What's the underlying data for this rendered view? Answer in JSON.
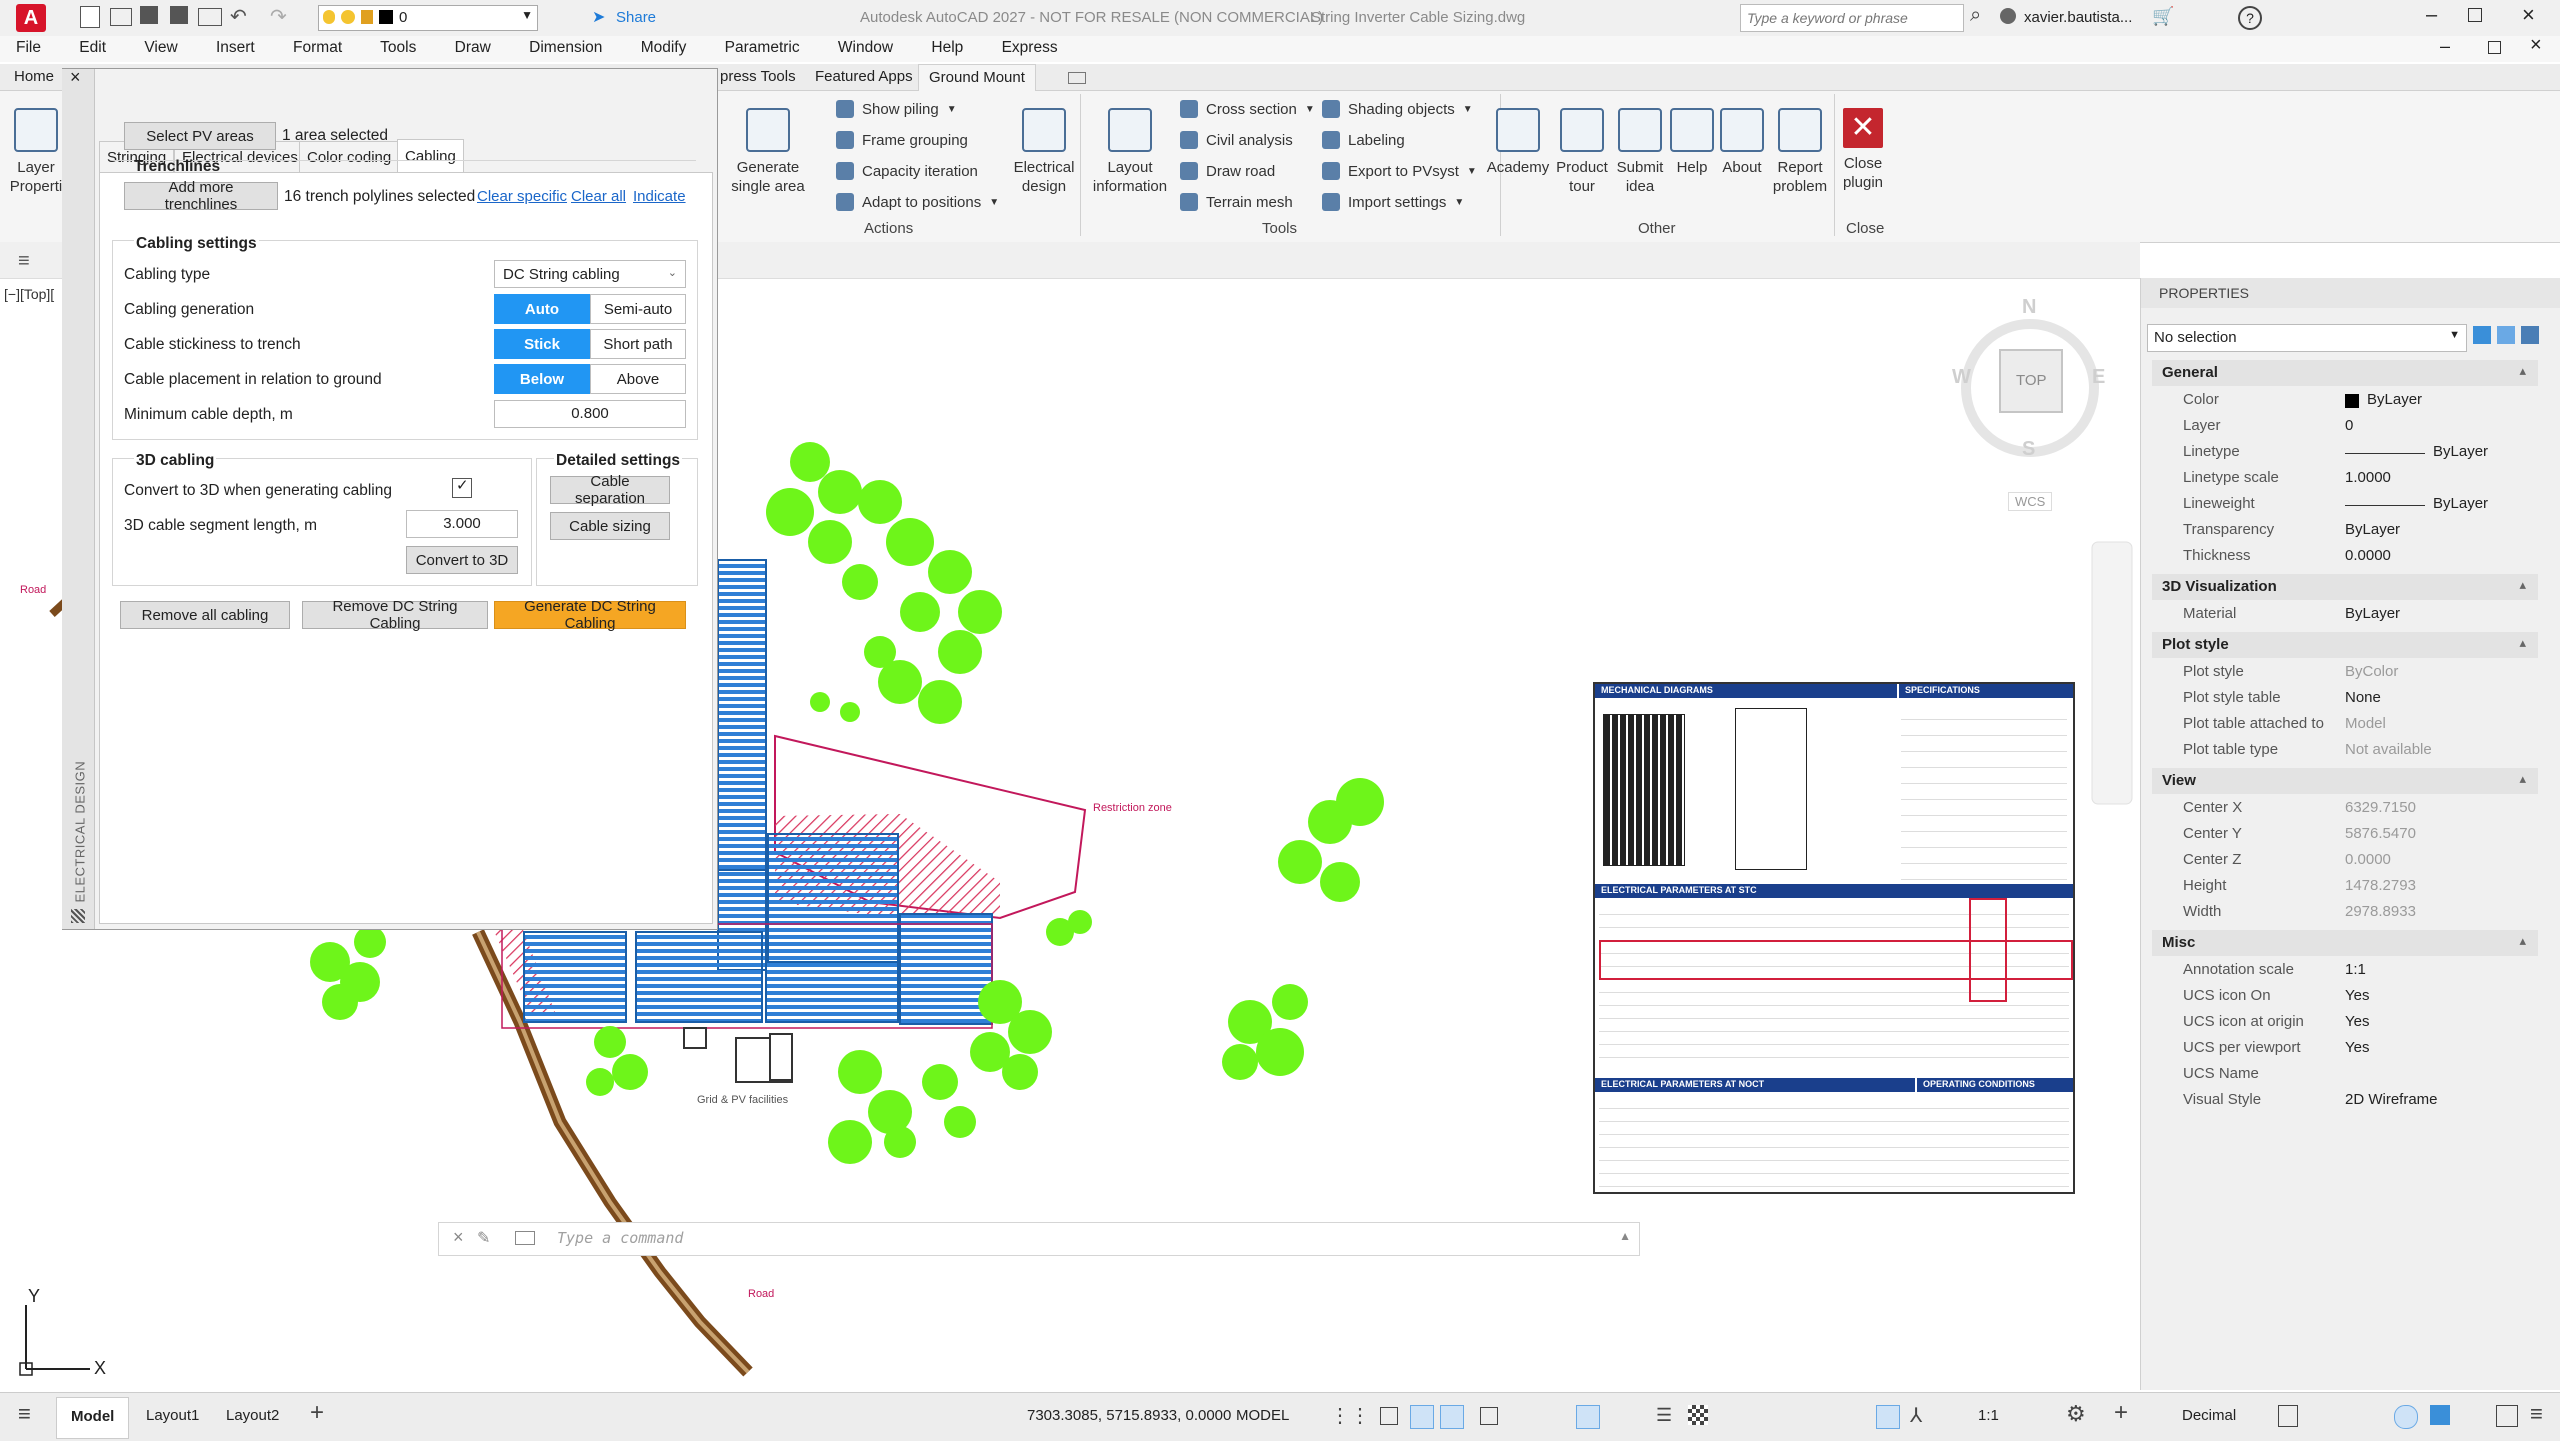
{
  "titlebar": {
    "app_title": "Autodesk AutoCAD 2027 - NOT FOR RESALE (NON COMMERCIAL)",
    "file_name": "String Inverter Cable Sizing.dwg",
    "search_placeholder": "Type a keyword or phrase",
    "user": "xavier.bautista...",
    "layer_value": "0",
    "share_label": "Share",
    "logo_letter": "A"
  },
  "menubar": [
    "File",
    "Edit",
    "View",
    "Insert",
    "Format",
    "Tools",
    "Draw",
    "Dimension",
    "Modify",
    "Parametric",
    "Window",
    "Help",
    "Express"
  ],
  "ribbon_tabs": [
    "Home",
    "press Tools",
    "Featured Apps",
    "Ground Mount"
  ],
  "ribbon_left_label": "Layer Properti",
  "ribbon": {
    "generate_single_area": "Generate single area",
    "show_piling": "Show piling",
    "frame_grouping": "Frame grouping",
    "capacity_iteration": "Capacity iteration",
    "adapt_to_positions": "Adapt to positions",
    "electrical_design": "Electrical design",
    "actions_group": "Actions",
    "layout_information": "Layout information",
    "cross_section": "Cross section",
    "civil_analysis": "Civil analysis",
    "draw_road": "Draw road",
    "terrain_mesh": "Terrain mesh",
    "shading_objects": "Shading objects",
    "labeling": "Labeling",
    "export_to_pvsyst": "Export to PVsyst",
    "import_settings": "Import settings",
    "tools_group": "Tools",
    "academy": "Academy",
    "product_tour": "Product tour",
    "submit_idea": "Submit idea",
    "help": "Help",
    "about": "About",
    "report_problem": "Report problem",
    "other_group": "Other",
    "close_plugin": "Close plugin",
    "close_group": "Close"
  },
  "viewport_label": "[−][Top][",
  "panel": {
    "side_label": "ELECTRICAL DESIGN",
    "tabs": [
      "Stringing",
      "Electrical devices",
      "Color coding",
      "Cabling"
    ],
    "active_tab": "Cabling",
    "select_pv_areas": "Select PV areas",
    "area_selected": "1 area selected",
    "trenchlines_heading": "Trenchlines",
    "add_more_trenchlines": "Add more trenchlines",
    "trench_selected": "16 trench polylines selected",
    "clear_specific": "Clear specific",
    "clear_all": "Clear all",
    "indicate": "Indicate",
    "cabling_settings_heading": "Cabling settings",
    "cabling_type_label": "Cabling type",
    "cabling_type_value": "DC String cabling",
    "cabling_generation_label": "Cabling generation",
    "gen_auto": "Auto",
    "gen_semi": "Semi-auto",
    "stickiness_label": "Cable stickiness to trench",
    "stick": "Stick",
    "short_path": "Short path",
    "placement_label": "Cable placement in relation to ground",
    "below": "Below",
    "above": "Above",
    "min_depth_label": "Minimum cable depth, m",
    "min_depth_value": "0.800",
    "cabling3d_heading": "3D cabling",
    "convert_label": "Convert to 3D when generating cabling",
    "segment_label": "3D cable segment length, m",
    "segment_value": "3.000",
    "convert_to_3d": "Convert to 3D",
    "detailed_heading": "Detailed settings",
    "cable_separation": "Cable separation",
    "cable_sizing": "Cable sizing",
    "remove_all": "Remove all cabling",
    "remove_dc": "Remove DC String Cabling",
    "generate_dc": "Generate DC String Cabling"
  },
  "drawing": {
    "road1": "Road",
    "road2": "Road",
    "restriction_zone": "Restriction zone",
    "grid_pv": "Grid & PV facilities",
    "compass_n": "N",
    "compass_s": "S",
    "compass_e": "E",
    "compass_w": "W",
    "compass_top": "TOP",
    "wcs": "WCS",
    "axis_y": "Y",
    "axis_x": "X"
  },
  "datasheet": {
    "mechanical": "MECHANICAL DIAGRAMS",
    "specifications": "SPECIFICATIONS",
    "stc": "ELECTRICAL PARAMETERS AT STC",
    "noct": "ELECTRICAL PARAMETERS AT NOCT",
    "operating": "OPERATING CONDITIONS"
  },
  "command": {
    "placeholder": "Type a command"
  },
  "properties": {
    "title": "PROPERTIES",
    "selection": "No selection",
    "sections": [
      {
        "name": "General",
        "rows": [
          {
            "k": "Color",
            "v": "ByLayer",
            "dim": false
          },
          {
            "k": "Layer",
            "v": "0",
            "dim": false
          },
          {
            "k": "Linetype",
            "v": "ByLayer",
            "dim": false
          },
          {
            "k": "Linetype scale",
            "v": "1.0000",
            "dim": false
          },
          {
            "k": "Lineweight",
            "v": "ByLayer",
            "dim": false
          },
          {
            "k": "Transparency",
            "v": "ByLayer",
            "dim": false
          },
          {
            "k": "Thickness",
            "v": "0.0000",
            "dim": false
          }
        ]
      },
      {
        "name": "3D Visualization",
        "rows": [
          {
            "k": "Material",
            "v": "ByLayer",
            "dim": false
          }
        ]
      },
      {
        "name": "Plot style",
        "rows": [
          {
            "k": "Plot style",
            "v": "ByColor",
            "dim": true
          },
          {
            "k": "Plot style table",
            "v": "None",
            "dim": false
          },
          {
            "k": "Plot table attached to",
            "v": "Model",
            "dim": true
          },
          {
            "k": "Plot table type",
            "v": "Not available",
            "dim": true
          }
        ]
      },
      {
        "name": "View",
        "rows": [
          {
            "k": "Center X",
            "v": "6329.7150",
            "dim": true
          },
          {
            "k": "Center Y",
            "v": "5876.5470",
            "dim": true
          },
          {
            "k": "Center Z",
            "v": "0.0000",
            "dim": true
          },
          {
            "k": "Height",
            "v": "1478.2793",
            "dim": true
          },
          {
            "k": "Width",
            "v": "2978.8933",
            "dim": true
          }
        ]
      },
      {
        "name": "Misc",
        "rows": [
          {
            "k": "Annotation scale",
            "v": "1:1",
            "dim": false
          },
          {
            "k": "UCS icon On",
            "v": "Yes",
            "dim": false
          },
          {
            "k": "UCS icon at origin",
            "v": "Yes",
            "dim": false
          },
          {
            "k": "UCS per viewport",
            "v": "Yes",
            "dim": false
          },
          {
            "k": "UCS Name",
            "v": "",
            "dim": false
          },
          {
            "k": "Visual Style",
            "v": "2D Wireframe",
            "dim": false
          }
        ]
      }
    ]
  },
  "statusbar": {
    "model_tab": "Model",
    "layout1": "Layout1",
    "layout2": "Layout2",
    "coords": "7303.3085, 5715.8933, 0.0000",
    "model": "MODEL",
    "scale": "1:1",
    "units": "Decimal"
  },
  "colors": {
    "accent": "#2196f3",
    "generate": "#f5a623",
    "restriction": "#c2185b",
    "tree": "#6ef51a",
    "road": "#7b4a1c",
    "panel_rows": "#2f7fd6"
  }
}
